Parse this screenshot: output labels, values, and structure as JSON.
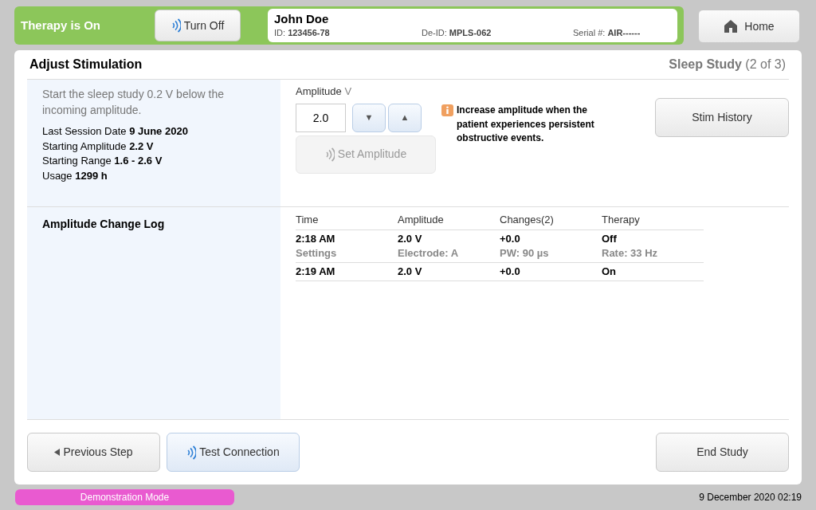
{
  "header": {
    "therapy_status": "Therapy is On",
    "therapy_on": true,
    "turn_off_button": "Turn Off",
    "patient": {
      "name": "John Doe",
      "fields": [
        {
          "label": "ID:",
          "value": "123456-78"
        },
        {
          "label": "De-ID:",
          "value": "MPLS-062"
        },
        {
          "label": "Serial #:",
          "value": "AIR------"
        }
      ]
    },
    "home_button": "Home"
  },
  "panel": {
    "title": "Adjust Stimulation",
    "step_name": "Sleep Study",
    "step_count": "(2  of  3)"
  },
  "instructions": "Start the sleep study 0.2 V below the incoming amplitude.",
  "session_info": [
    {
      "label": "Last Session Date",
      "value": "9 June 2020"
    },
    {
      "label": "Starting Amplitude",
      "value": "2.2 V"
    },
    {
      "label": "Starting Range",
      "value": "1.6  -  2.6 V"
    },
    {
      "label": "Usage",
      "value": "1299 h"
    }
  ],
  "amplitude": {
    "label": "Amplitude",
    "unit": "V",
    "value": "2.0",
    "decrease_button": "▼",
    "increase_button": "▲",
    "set_button": "Set Amplitude",
    "set_disabled": true
  },
  "tip": "Increase amplitude when the patient experiences persistent obstructive events.",
  "stim_history_button": "Stim History",
  "change_log": {
    "title": "Amplitude Change Log",
    "columns": [
      "Time",
      "Amplitude",
      "Changes(2)",
      "Therapy"
    ],
    "rows": [
      {
        "cells": [
          "2:18 AM",
          "2.0 V",
          "+0.0",
          "Off"
        ],
        "details": [
          "Settings",
          "Electrode: A",
          "PW: 90 µs",
          "Rate: 33 Hz"
        ]
      },
      {
        "cells": [
          "2:19 AM",
          "2.0 V",
          "+0.0",
          "On"
        ],
        "details": []
      }
    ]
  },
  "footer": {
    "previous_button": "Previous Step",
    "test_button": "Test Connection",
    "end_button": "End Study"
  },
  "status_bar": {
    "mode": "Demonstration Mode",
    "datetime": "9 December 2020 02:19"
  }
}
